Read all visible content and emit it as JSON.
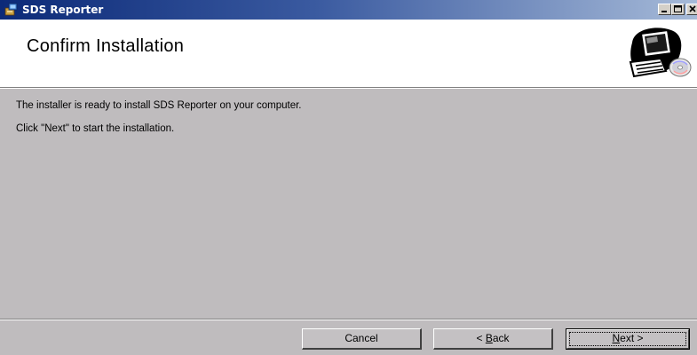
{
  "window": {
    "title": "SDS Reporter",
    "title_bar_color": "#0c2a78",
    "app_icon": "installer-icon"
  },
  "header": {
    "title": "Confirm Installation",
    "art_icon": "computer-cd-icon"
  },
  "body": {
    "line1": "The installer is ready to install SDS Reporter on your computer.",
    "line2": "Click \"Next\" to start the installation."
  },
  "buttons": {
    "cancel": "Cancel",
    "back_prefix": "< ",
    "back_mnemonic": "B",
    "back_rest": "ack",
    "next_mnemonic": "N",
    "next_rest": "ext >"
  },
  "title_buttons": {
    "minimize": "minimize-icon",
    "maximize": "maximize-icon",
    "close": "close-icon"
  }
}
